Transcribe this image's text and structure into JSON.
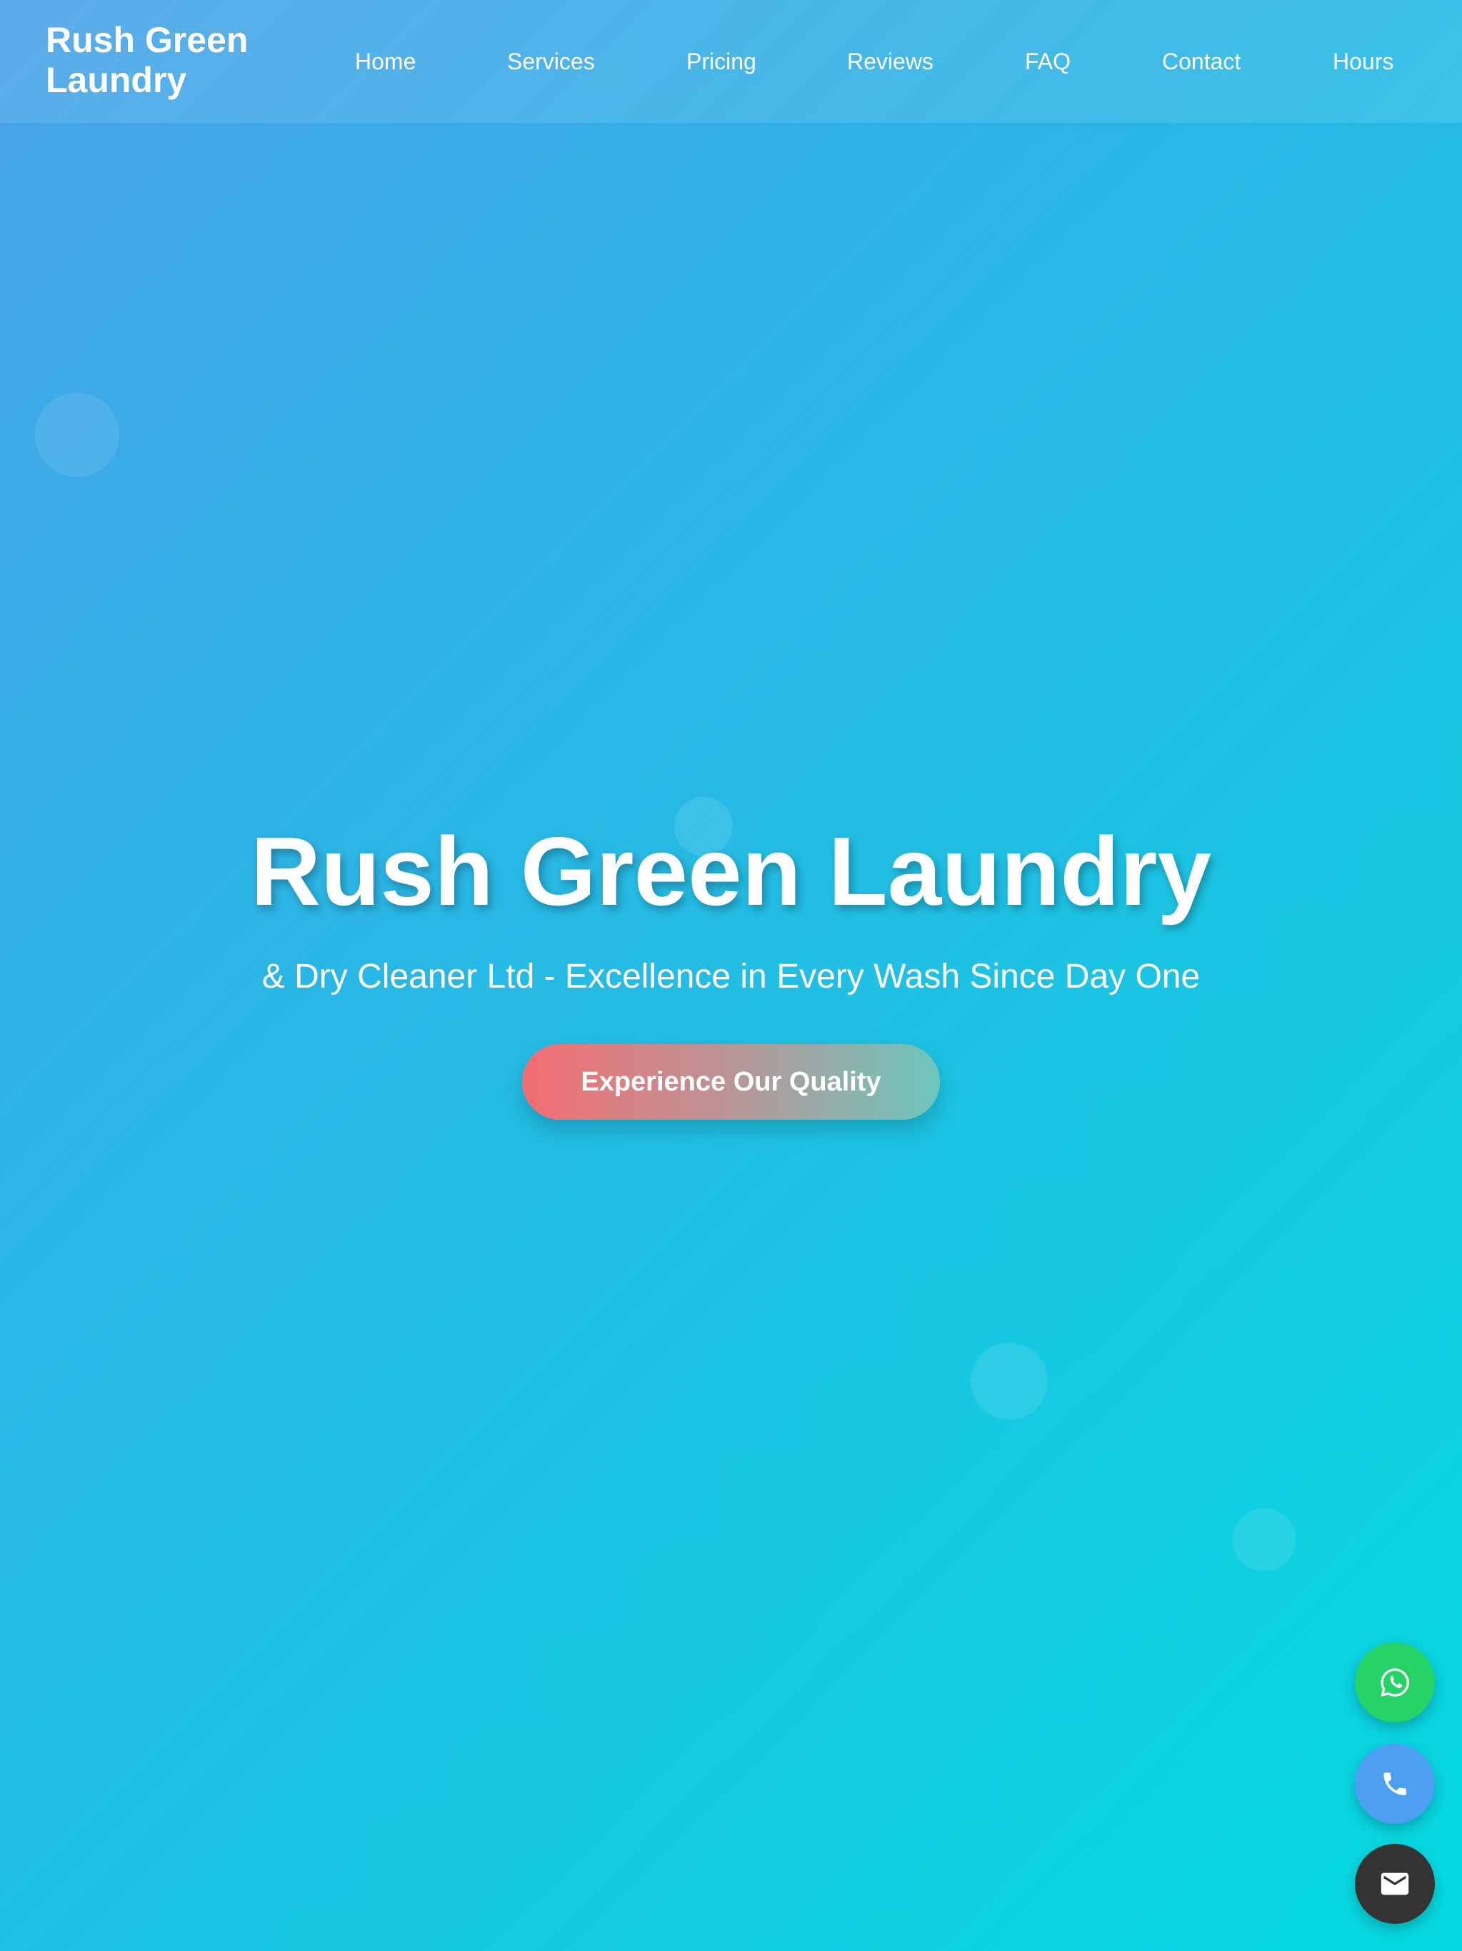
{
  "brand": {
    "logo": "Rush Green Laundry"
  },
  "nav": {
    "items": [
      {
        "label": "Home"
      },
      {
        "label": "Services"
      },
      {
        "label": "Pricing"
      },
      {
        "label": "Reviews"
      },
      {
        "label": "FAQ"
      },
      {
        "label": "Contact"
      },
      {
        "label": "Hours"
      }
    ]
  },
  "hero": {
    "title": "Rush Green Laundry",
    "subtitle": "& Dry Cleaner Ltd - Excellence in Every Wash Since Day One",
    "cta_label": "Experience Our Quality"
  },
  "contact_buttons": [
    {
      "icon": "whatsapp-icon",
      "color": "#25d366"
    },
    {
      "icon": "phone-icon",
      "color": "#4c9ff3"
    },
    {
      "icon": "email-icon",
      "color": "#333333"
    }
  ],
  "colors": {
    "background_start": "#4aa3e8",
    "background_end": "#05d9e0",
    "cta_start": "#f46d72",
    "cta_end": "#6cc7bd"
  }
}
